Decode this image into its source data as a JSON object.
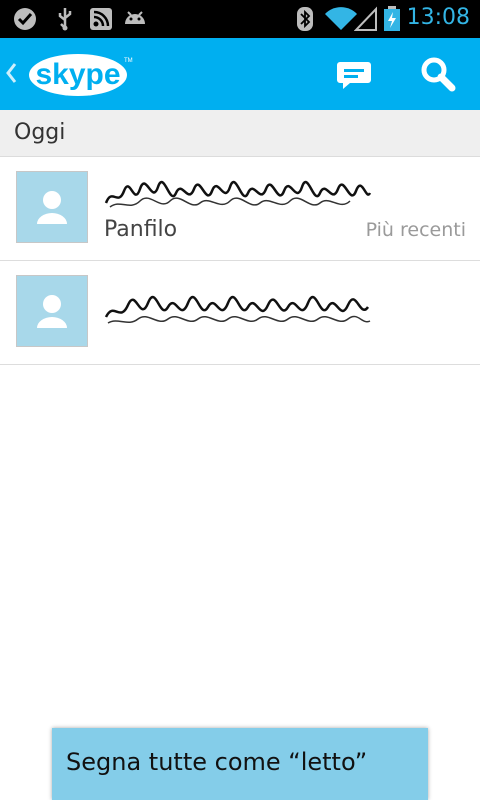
{
  "status_bar": {
    "time": "13:08",
    "icons": [
      "check-circle-icon",
      "usb-icon",
      "rss-icon",
      "android-icon",
      "bluetooth-icon",
      "wifi-icon",
      "signal-icon",
      "battery-charging-icon"
    ]
  },
  "action_bar": {
    "logo_text": "skype",
    "icons": [
      "back-chevron-icon",
      "chat-bubble-icon",
      "search-icon"
    ],
    "accent": "#00aff0"
  },
  "section": {
    "title": "Oggi"
  },
  "conversations": [
    {
      "subtitle": "Panfilo",
      "meta": "Più recenti"
    },
    {
      "subtitle": "",
      "meta": ""
    }
  ],
  "popup": {
    "label": "Segna tutte come “letto”"
  },
  "colors": {
    "status_icon": "#33b5e5",
    "avatar_bg": "#a8d8ea",
    "popup_bg": "#84cde9",
    "meta_text": "#9a9a9a"
  }
}
